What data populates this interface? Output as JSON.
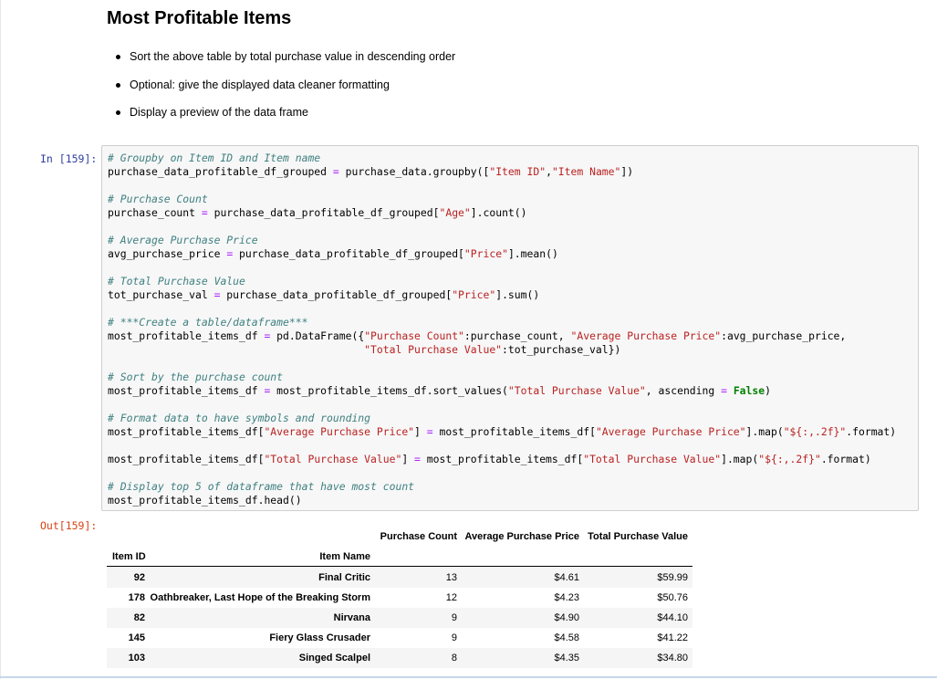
{
  "markdown": {
    "title": "Most Profitable Items",
    "bullets": [
      "Sort the above table by total purchase value in descending order",
      "Optional: give the displayed data cleaner formatting",
      "Display a preview of the data frame"
    ]
  },
  "cell": {
    "in_prompt": "In [159]:",
    "out_prompt": "Out[159]:",
    "code": [
      "# Groupby on Item ID and Item name",
      "purchase_data_profitable_df_grouped = purchase_data.groupby([\"Item ID\",\"Item Name\"])",
      "",
      "# Purchase Count",
      "purchase_count = purchase_data_profitable_df_grouped[\"Age\"].count()",
      "",
      "# Average Purchase Price",
      "avg_purchase_price = purchase_data_profitable_df_grouped[\"Price\"].mean()",
      "",
      "# Total Purchase Value",
      "tot_purchase_val = purchase_data_profitable_df_grouped[\"Price\"].sum()",
      "",
      "# ***Create a table/dataframe***",
      "most_profitable_items_df = pd.DataFrame({\"Purchase Count\":purchase_count, \"Average Purchase Price\":avg_purchase_price,",
      "                                         \"Total Purchase Value\":tot_purchase_val})",
      "",
      "# Sort by the purchase count",
      "most_profitable_items_df = most_profitable_items_df.sort_values(\"Total Purchase Value\", ascending = False)",
      "",
      "# Format data to have symbols and rounding",
      "most_profitable_items_df[\"Average Purchase Price\"] = most_profitable_items_df[\"Average Purchase Price\"].map(\"${:,.2f}\".format)",
      "",
      "most_profitable_items_df[\"Total Purchase Value\"] = most_profitable_items_df[\"Total Purchase Value\"].map(\"${:,.2f}\".format)",
      "",
      "# Display top 5 of dataframe that have most count",
      "most_profitable_items_df.head()"
    ]
  },
  "output_table": {
    "columns": [
      "Purchase Count",
      "Average Purchase Price",
      "Total Purchase Value"
    ],
    "index_names": [
      "Item ID",
      "Item Name"
    ],
    "rows": [
      {
        "item_id": "92",
        "item_name": "Final Critic",
        "count": "13",
        "avg": "$4.61",
        "total": "$59.99"
      },
      {
        "item_id": "178",
        "item_name": "Oathbreaker, Last Hope of the Breaking Storm",
        "count": "12",
        "avg": "$4.23",
        "total": "$50.76"
      },
      {
        "item_id": "82",
        "item_name": "Nirvana",
        "count": "9",
        "avg": "$4.90",
        "total": "$44.10"
      },
      {
        "item_id": "145",
        "item_name": "Fiery Glass Crusader",
        "count": "9",
        "avg": "$4.58",
        "total": "$41.22"
      },
      {
        "item_id": "103",
        "item_name": "Singed Scalpel",
        "count": "8",
        "avg": "$4.35",
        "total": "$34.80"
      }
    ]
  }
}
